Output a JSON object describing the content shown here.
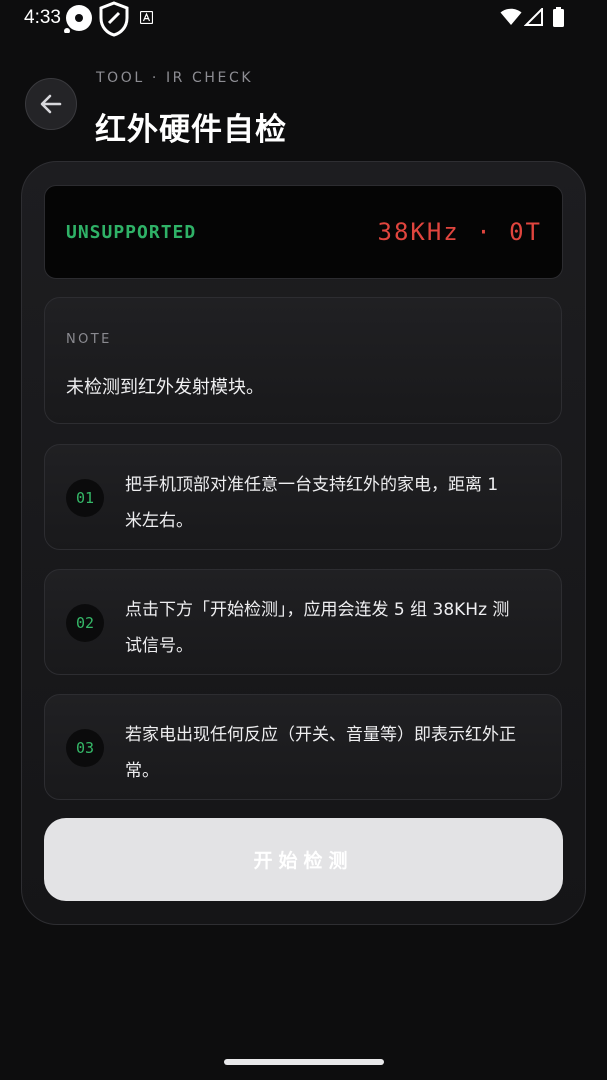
{
  "status_bar": {
    "time": "4:33",
    "icons": [
      "record-icon",
      "shield-icon",
      "keyboard-a-icon",
      "wifi-icon",
      "signal-icon",
      "battery-icon"
    ]
  },
  "header": {
    "eyebrow": "TOOL · IR CHECK",
    "title": "红外硬件自检",
    "back_icon": "arrow-left-icon"
  },
  "display": {
    "status": "UNSUPPORTED",
    "frequency": "38KHz · 0T",
    "status_color": "#2fb267",
    "frequency_color": "#e0453e"
  },
  "note": {
    "label": "NOTE",
    "text": "未检测到红外发射模块。"
  },
  "steps": [
    {
      "number": "01",
      "line1": "把手机顶部对准任意一台支持红外的家电，距离 1",
      "line2": "米左右。"
    },
    {
      "number": "02",
      "line1": "点击下方「开始检测」，应用会连发 5 组 38KHz 测",
      "line2": "试信号。"
    },
    {
      "number": "03",
      "line1": "若家电出现任何反应（开关、音量等）即表示红外正",
      "line2": "常。"
    }
  ],
  "start_button": {
    "label": "开始检测"
  },
  "colors": {
    "background": "#0d0d0e",
    "accent_green": "#35b868",
    "accent_red": "#e0453e",
    "button_bg": "#e3e3e5"
  }
}
